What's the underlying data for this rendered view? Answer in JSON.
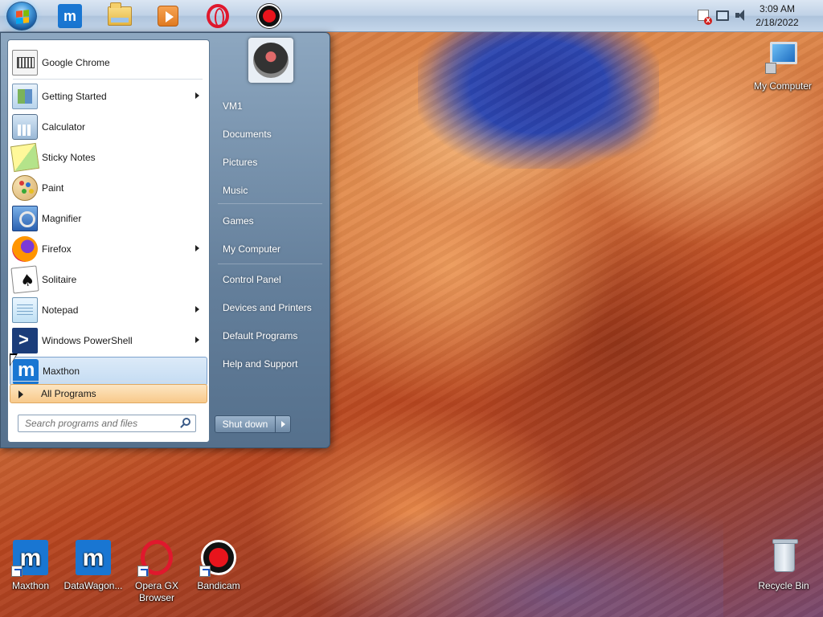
{
  "taskbar": {
    "pinned": [
      {
        "name": "Maxthon",
        "icon": "maxthon-icon"
      },
      {
        "name": "Windows Explorer",
        "icon": "folder-icon"
      },
      {
        "name": "Media Player",
        "icon": "media-player-icon"
      },
      {
        "name": "Opera GX",
        "icon": "opera-icon"
      },
      {
        "name": "Bandicam",
        "icon": "bandicam-icon"
      }
    ],
    "tray_icons": [
      "action-center-icon",
      "network-icon",
      "volume-icon"
    ],
    "time": "3:09 AM",
    "date": "2/18/2022"
  },
  "start_menu": {
    "programs": [
      {
        "label": "Google Chrome",
        "icon": "chrome-icon",
        "has_submenu": false
      },
      {
        "label": "Getting Started",
        "icon": "getting-started-icon",
        "has_submenu": true
      },
      {
        "label": "Calculator",
        "icon": "calculator-icon",
        "has_submenu": false
      },
      {
        "label": "Sticky Notes",
        "icon": "sticky-notes-icon",
        "has_submenu": false
      },
      {
        "label": "Paint",
        "icon": "paint-icon",
        "has_submenu": false
      },
      {
        "label": "Magnifier",
        "icon": "magnifier-icon",
        "has_submenu": false
      },
      {
        "label": "Firefox",
        "icon": "firefox-icon",
        "has_submenu": true
      },
      {
        "label": "Solitaire",
        "icon": "solitaire-icon",
        "has_submenu": false
      },
      {
        "label": "Notepad",
        "icon": "notepad-icon",
        "has_submenu": true
      },
      {
        "label": "Windows PowerShell",
        "icon": "powershell-icon",
        "has_submenu": true
      },
      {
        "label": "Maxthon",
        "icon": "maxthon-icon",
        "has_submenu": false,
        "highlighted": true
      }
    ],
    "all_programs": "All Programs",
    "search_placeholder": "Search programs and files",
    "right_links": [
      {
        "label": "VM1"
      },
      {
        "label": "Documents"
      },
      {
        "label": "Pictures"
      },
      {
        "label": "Music"
      },
      {
        "label": "Games"
      },
      {
        "label": "My Computer"
      },
      {
        "label": "Control Panel"
      },
      {
        "label": "Devices and Printers"
      },
      {
        "label": "Default Programs"
      },
      {
        "label": "Help and Support"
      }
    ],
    "shutdown_label": "Shut down"
  },
  "desktop": {
    "icons": [
      {
        "label": "My Computer",
        "icon": "computer-icon"
      },
      {
        "label": "Maxthon",
        "icon": "maxthon-icon"
      },
      {
        "label": "DataWagon...",
        "icon": "maxthon-icon"
      },
      {
        "label": "Opera GX Browser",
        "icon": "opera-icon"
      },
      {
        "label": "Bandicam",
        "icon": "bandicam-icon"
      },
      {
        "label": "Recycle Bin",
        "icon": "recycle-bin-icon"
      }
    ]
  },
  "colors": {
    "start_menu_highlight": "#c4dcf3",
    "all_programs_bg": "#f8c98a",
    "taskbar_bg": "#bfd1e6"
  }
}
